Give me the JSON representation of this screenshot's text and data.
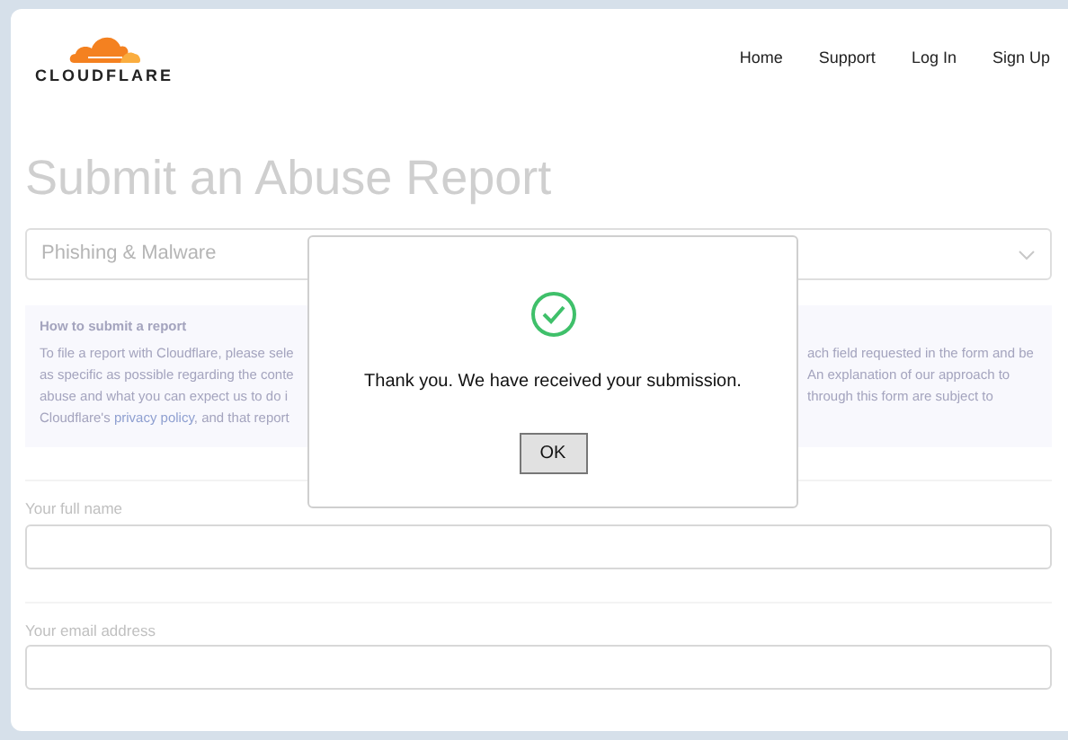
{
  "header": {
    "logo_text": "CLOUDFLARE",
    "nav": [
      "Home",
      "Support",
      "Log In",
      "Sign Up"
    ]
  },
  "page_title": "Submit an Abuse Report",
  "category_select": {
    "value": "Phishing & Malware"
  },
  "info_box": {
    "title": "How to submit a report",
    "left_lines": [
      {
        "text": "To file a report with Cloudflare, please sele"
      },
      {
        "text": "as specific as possible regarding the conte"
      },
      {
        "text": "abuse and what you can expect us to do i"
      },
      {
        "before": "Cloudflare's ",
        "link": "privacy policy",
        "after": ", and that report"
      }
    ],
    "right_lines": [
      "ach field requested in the form and be",
      "An explanation of our approach to",
      "through this form are subject to"
    ]
  },
  "fields": [
    {
      "label": "Your full name"
    },
    {
      "label": "Your email address"
    }
  ],
  "dialog": {
    "message": "Thank you. We have received your submission.",
    "button": "OK"
  }
}
